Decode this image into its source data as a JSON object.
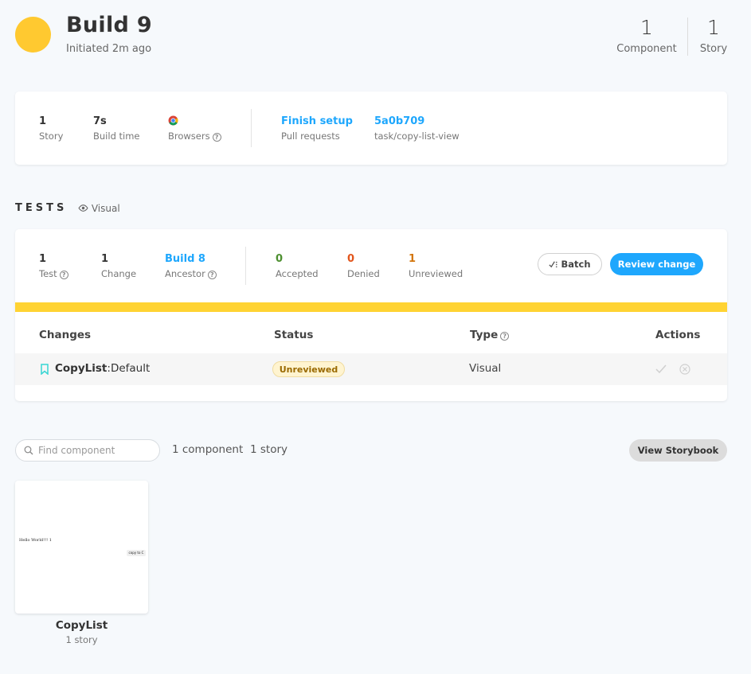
{
  "header": {
    "title": "Build 9",
    "initiated": "Initiated 2m ago",
    "status_color": "#ffc930",
    "stats": [
      {
        "value": "1",
        "label": "Component"
      },
      {
        "value": "1",
        "label": "Story"
      }
    ]
  },
  "build_info": {
    "story": {
      "value": "1",
      "label": "Story"
    },
    "build_time": {
      "value": "7s",
      "label": "Build time"
    },
    "browsers": {
      "icon": "chrome-icon",
      "label": "Browsers"
    },
    "pull_requests": {
      "value": "Finish setup",
      "label": "Pull requests"
    },
    "commit": {
      "value": "5a0b709",
      "label": "task/copy-list-view"
    }
  },
  "tests": {
    "title": "TESTS",
    "mode_icon": "eye-icon",
    "mode_label": "Visual",
    "summary": {
      "test": {
        "value": "1",
        "label": "Test"
      },
      "change": {
        "value": "1",
        "label": "Change"
      },
      "ancestor": {
        "value": "Build 8",
        "label": "Ancestor"
      },
      "accepted": {
        "value": "0",
        "label": "Accepted",
        "color": "#4c8f2f"
      },
      "denied": {
        "value": "0",
        "label": "Denied",
        "color": "#e2551c"
      },
      "unreviewed": {
        "value": "1",
        "label": "Unreviewed",
        "color": "#d3760c"
      }
    },
    "batch_label": "Batch",
    "review_label": "Review change",
    "table": {
      "headers": {
        "changes": "Changes",
        "status": "Status",
        "type": "Type",
        "actions": "Actions"
      },
      "rows": [
        {
          "component": "CopyList",
          "story": "Default",
          "status": "Unreviewed",
          "type": "Visual"
        }
      ]
    }
  },
  "components": {
    "search_placeholder": "Find component",
    "component_count": "1 component",
    "story_count": "1 story",
    "view_storybook_label": "View Storybook",
    "cards": [
      {
        "name": "CopyList",
        "stories": "1 story",
        "preview_text": "Hello World!!! 1",
        "preview_button": "copy to C"
      }
    ]
  },
  "colors": {
    "accent": "#1ea7fd",
    "warning_bar": "#ffd333",
    "background": "#f6f9fc"
  }
}
